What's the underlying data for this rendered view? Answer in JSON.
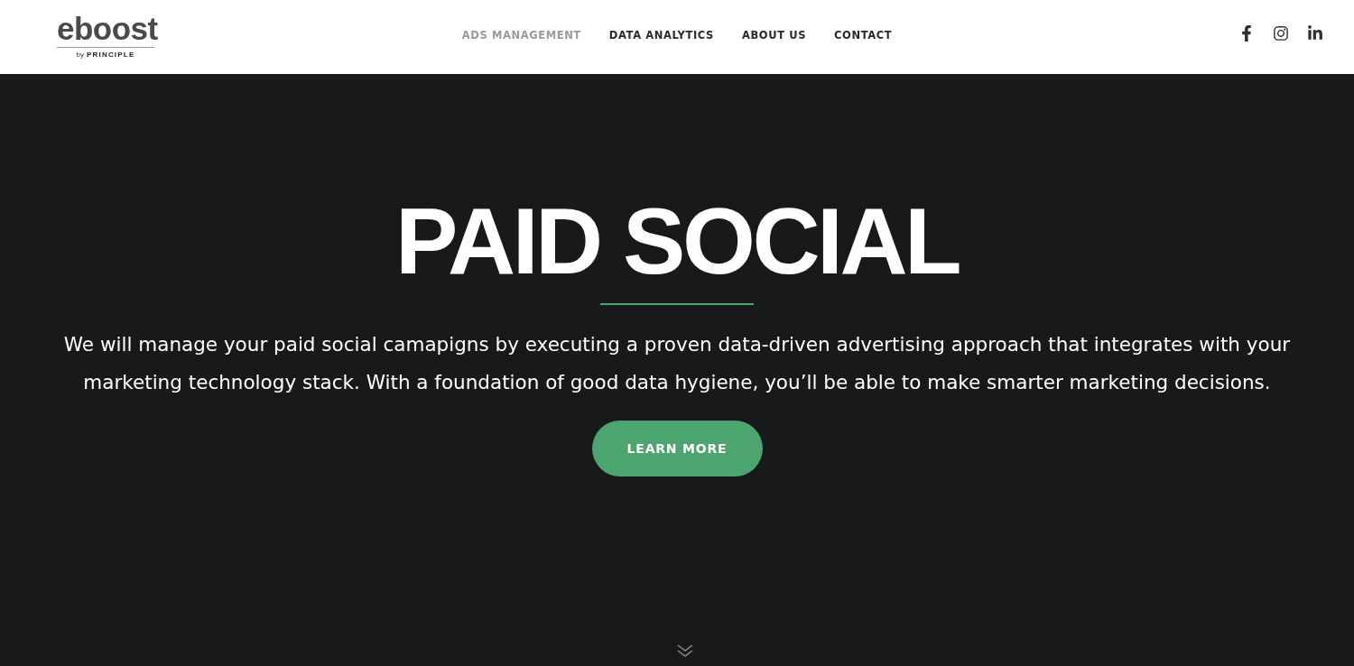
{
  "logo": {
    "wordmark": "eboost",
    "by": "by",
    "company": "PRINCIPLE"
  },
  "nav": [
    {
      "label": "ADS MANAGEMENT",
      "selected": true
    },
    {
      "label": "DATA ANALYTICS",
      "selected": false
    },
    {
      "label": "ABOUT US",
      "selected": false
    },
    {
      "label": "CONTACT",
      "selected": false
    }
  ],
  "social": [
    {
      "kind": "facebook"
    },
    {
      "kind": "instagram"
    },
    {
      "kind": "linkedin"
    }
  ],
  "hero": {
    "title": "PAID SOCIAL",
    "text": "We will manage your paid social camapigns by executing a proven data-driven advertising approach that integrates with your marketing technology stack. With a foundation of good data hygiene, you’ll be able to make smarter marketing decisions.",
    "button": "LEARN MORE"
  }
}
